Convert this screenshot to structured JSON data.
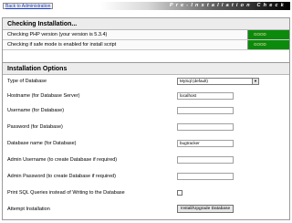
{
  "header": {
    "back_link": "Back to Administration",
    "banner_title": "Pre-Installation Check"
  },
  "checking": {
    "title": "Checking Installation...",
    "rows": [
      {
        "label": "Checking PHP version (your version is 5.3.4)",
        "status": "GOOD",
        "status_color": "#0c8a0c"
      },
      {
        "label": "Checking if safe mode is enabled for install script",
        "status": "GOOD",
        "status_color": "#0c8a0c"
      }
    ]
  },
  "options": {
    "title": "Installation Options",
    "database_type": {
      "label": "Type of Database",
      "value": "MySql (default)"
    },
    "hostname": {
      "label": "Hostname (for Database Server)",
      "value": "localhost"
    },
    "username": {
      "label": "Username (for Database)",
      "value": ""
    },
    "password": {
      "label": "Password (for Database)",
      "value": ""
    },
    "database_name": {
      "label": "Database name (for Database)",
      "value": "bugtracker"
    },
    "admin_username": {
      "label": "Admin Username (to create Database if required)",
      "value": ""
    },
    "admin_password": {
      "label": "Admin Password (to create Database if required)",
      "value": ""
    },
    "print_sql": {
      "label": "Print SQL Queries instead of Writing to the Database",
      "checked": false
    },
    "attempt": {
      "label": "Attempt Installation",
      "button": "Install/Upgrade Database"
    }
  }
}
